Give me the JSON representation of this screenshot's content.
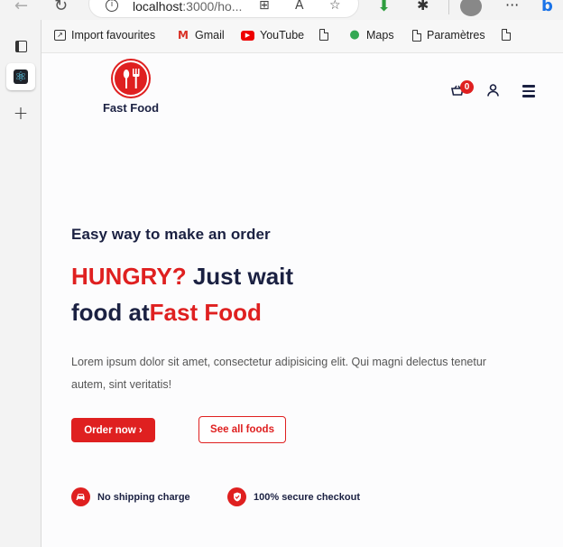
{
  "browser": {
    "url_host": "localhost",
    "url_rest": ":3000/ho..."
  },
  "bookmarks": [
    {
      "label": "Import favourites",
      "icon": "import-icon"
    },
    {
      "label": "Gmail",
      "icon": "gmail-icon"
    },
    {
      "label": "YouTube",
      "icon": "youtube-icon"
    },
    {
      "label": "",
      "icon": "document-icon"
    },
    {
      "label": "Maps",
      "icon": "maps-icon"
    },
    {
      "label": "Paramètres",
      "icon": "document-icon"
    }
  ],
  "site": {
    "brand": "Fast Food",
    "cart_count": "0"
  },
  "hero": {
    "subtitle": "Easy way to make an order",
    "headline_red": "HUNGRY?",
    "headline_rest": " Just wait",
    "headline_line2_prefix": "food at",
    "headline_line2_red": "Fast Food",
    "description": "Lorem ipsum dolor sit amet, consectetur adipisicing elit. Qui magni delectus tenetur autem, sint veritatis!",
    "order_button": "Order now ›",
    "all_foods_button": "See all foods"
  },
  "features": [
    {
      "label": "No shipping charge",
      "icon": "car-icon"
    },
    {
      "label": "100% secure checkout",
      "icon": "shield-icon"
    }
  ],
  "colors": {
    "accent": "#df2020",
    "heading": "#1b2142"
  }
}
